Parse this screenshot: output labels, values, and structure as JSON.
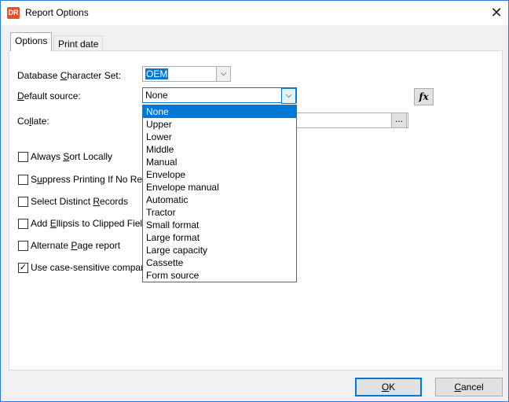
{
  "window": {
    "title": "Report Options",
    "app_icon_text": "DR",
    "close_glyph": "✕"
  },
  "tabs": [
    {
      "label": "Options",
      "active": true
    },
    {
      "label": "Print date",
      "active": false
    }
  ],
  "fields": {
    "charset": {
      "label_pre": "Database ",
      "label_key": "C",
      "label_post": "haracter Set:",
      "value": "OEM"
    },
    "default_source": {
      "label_key": "D",
      "label_post": "efault source:",
      "value": "None"
    },
    "collate": {
      "label_pre": "Co",
      "label_key": "l",
      "label_post": "late:",
      "value": "",
      "browse_label": "..."
    }
  },
  "fx_label": "fx",
  "checkboxes": [
    {
      "pre": "Always ",
      "key": "S",
      "post": "ort Locally",
      "checked": false
    },
    {
      "pre": "S",
      "key": "u",
      "post": "ppress Printing If No Rec",
      "checked": false
    },
    {
      "pre": "Select Distinct ",
      "key": "R",
      "post": "ecords",
      "checked": false
    },
    {
      "pre": "Add ",
      "key": "E",
      "post": "llipsis to Clipped Field",
      "checked": false
    },
    {
      "pre": "Alternate ",
      "key": "P",
      "post": "age report",
      "checked": false
    },
    {
      "pre": "Use case-sensitive compari",
      "key": "",
      "post": "",
      "checked": true
    }
  ],
  "dropdown": {
    "selected_index": 0,
    "options": [
      "None",
      "Upper",
      "Lower",
      "Middle",
      "Manual",
      "Envelope",
      "Envelope manual",
      "Automatic",
      "Tractor",
      "Small format",
      "Large format",
      "Large capacity",
      "Cassette",
      "Form source"
    ]
  },
  "buttons": {
    "ok": {
      "key": "O",
      "post": "K"
    },
    "cancel": {
      "pre": "",
      "key": "C",
      "post": "ancel"
    }
  },
  "colors": {
    "accent": "#0078d7",
    "window_border": "#2b79d8",
    "app_icon": "#e8502a"
  }
}
